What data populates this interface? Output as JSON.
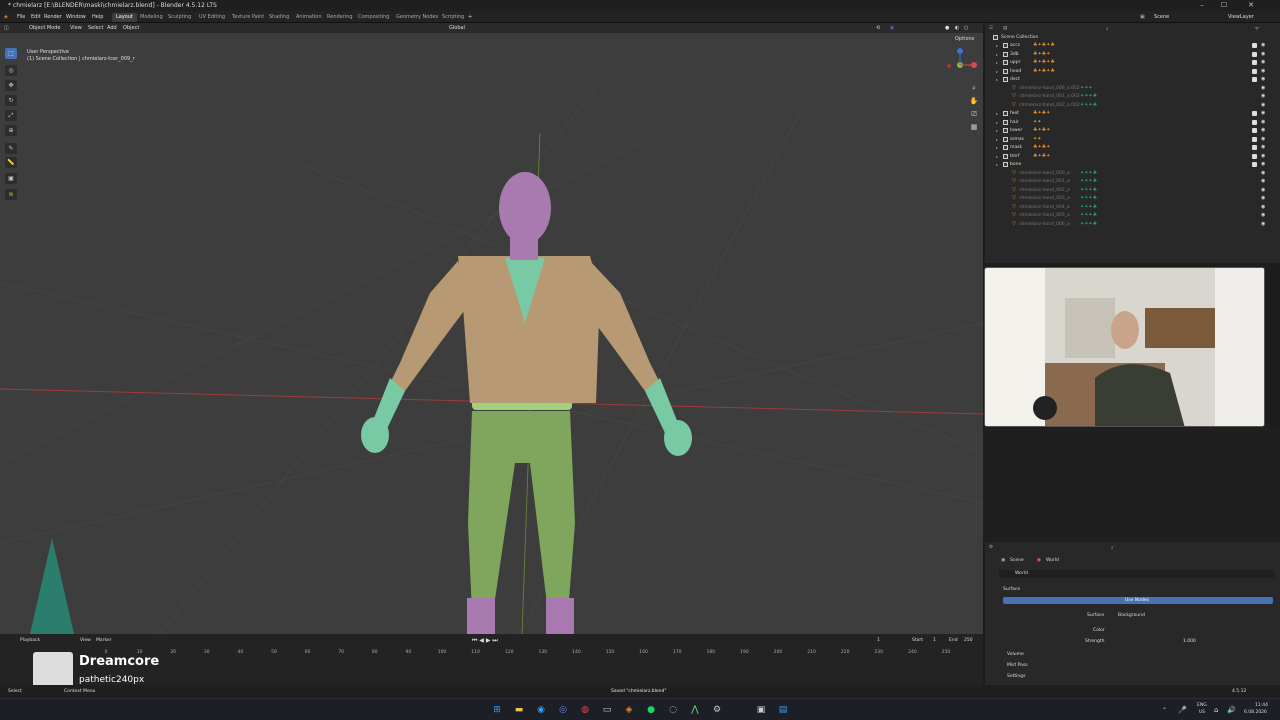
{
  "window": {
    "title": "* chmielarz [E:\\BLENDER\\maski\\chmielarz.blend] - Blender 4.5.12 LTS",
    "minimize": "–",
    "maximize": "☐",
    "close": "✕"
  },
  "menubar": {
    "items": [
      "File",
      "Edit",
      "Render",
      "Window",
      "Help"
    ],
    "workspaces": [
      "Layout",
      "Modeling",
      "Sculpting",
      "UV Editing",
      "Texture Paint",
      "Shading",
      "Animation",
      "Rendering",
      "Compositing",
      "Geometry Nodes",
      "Scripting"
    ],
    "active_workspace": "Layout",
    "scene": "Scene",
    "view_layer": "ViewLayer"
  },
  "viewport": {
    "mode": "Object Mode",
    "menus": [
      "View",
      "Select",
      "Add",
      "Object"
    ],
    "transform_orientation": "Global",
    "options": "Options",
    "info_line1": "User Perspective",
    "info_line2": "(1) Scene Collection | chmielarz-tcer_009_r"
  },
  "outliner": {
    "root": "Scene Collection",
    "search_placeholder": "",
    "collections": [
      {
        "label": "accs",
        "mods": "♣✦♣✦♣"
      },
      {
        "label": "3db",
        "mods": "♣✦♣✦"
      },
      {
        "label": "uppr",
        "mods": "♣✦♣✦♣"
      },
      {
        "label": "head",
        "mods": "♣✦♣✦♣"
      },
      {
        "label": "dect",
        "mods": ""
      },
      {
        "label": "chmielarz-hand_009_a.002",
        "mods": "✦✦✦",
        "sub": true
      },
      {
        "label": "chmielarz-hand_001_a.002",
        "mods": "✦✦✦♣",
        "sub": true
      },
      {
        "label": "chmielarz-hand_002_a.002",
        "mods": "✦✦✦♣",
        "sub": true
      },
      {
        "label": "feet",
        "mods": "♣✦♣✦"
      },
      {
        "label": "hair",
        "mods": "✦✦"
      },
      {
        "label": "lower",
        "mods": "♣✦♣✦"
      },
      {
        "label": "armas",
        "mods": "✦✦"
      },
      {
        "label": "mask",
        "mods": "♣✦♣✦"
      },
      {
        "label": "tmrf",
        "mods": "♣✦♣✦"
      },
      {
        "label": "bone",
        "mods": ""
      },
      {
        "label": "chmielarz-hand_000_a",
        "mods": "✦✦✦♣",
        "sub": true
      },
      {
        "label": "chmielarz-hand_001_a",
        "mods": "✦✦✦♣",
        "sub": true
      },
      {
        "label": "chmielarz-hand_002_a",
        "mods": "✦✦✦♣",
        "sub": true
      },
      {
        "label": "chmielarz-hand_003_a",
        "mods": "✦✦✦♣",
        "sub": true
      },
      {
        "label": "chmielarz-hand_004_a",
        "mods": "✦✦✦♣",
        "sub": true
      },
      {
        "label": "chmielarz-hand_005_a",
        "mods": "✦✦✦♣",
        "sub": true
      },
      {
        "label": "chmielarz-hand_006_a",
        "mods": "✦✦✦♣",
        "sub": true
      }
    ]
  },
  "properties": {
    "breadcrumb_scene": "Scene",
    "breadcrumb_world": "World",
    "world_name": "World",
    "surface_section": "Surface",
    "use_nodes": "Use Nodes",
    "surface_label": "Surface",
    "surface_value": "Background",
    "color_label": "Color",
    "strength_label": "Strength",
    "strength_value": "1.000",
    "volume_section": "Volume",
    "mist_section": "Mist Pass",
    "settings_section": "Settings"
  },
  "timeline": {
    "menus": [
      "Playback",
      "View",
      "Marker"
    ],
    "current_frame": "1",
    "start_label": "Start",
    "start": "1",
    "end_label": "End",
    "end": "250",
    "ticks": [
      "0",
      "10",
      "20",
      "30",
      "40",
      "50",
      "60",
      "70",
      "80",
      "90",
      "100",
      "110",
      "120",
      "130",
      "140",
      "150",
      "160",
      "170",
      "180",
      "190",
      "200",
      "210",
      "220",
      "230",
      "240",
      "250"
    ]
  },
  "overlay": {
    "song_title": "Dreamcore",
    "artist": "pathetic240px"
  },
  "statusbar": {
    "select": "Select",
    "context_menu": "Context Menu",
    "saved_message": "Saved \"chmielarz.blend\"",
    "version": "4.5.12"
  },
  "taskbar": {
    "lang": "ENG",
    "region": "US",
    "time": "11:44",
    "date": "6.08.2026"
  },
  "colors": {
    "accent": "#4772b3",
    "viewport_bg": "#3d3d3d",
    "modifier_orange": "#e88c2c",
    "shirt": "#b79a73",
    "pants": "#7fa65c",
    "skin_green": "#79c9a5",
    "head_purple": "#a87ab0"
  }
}
